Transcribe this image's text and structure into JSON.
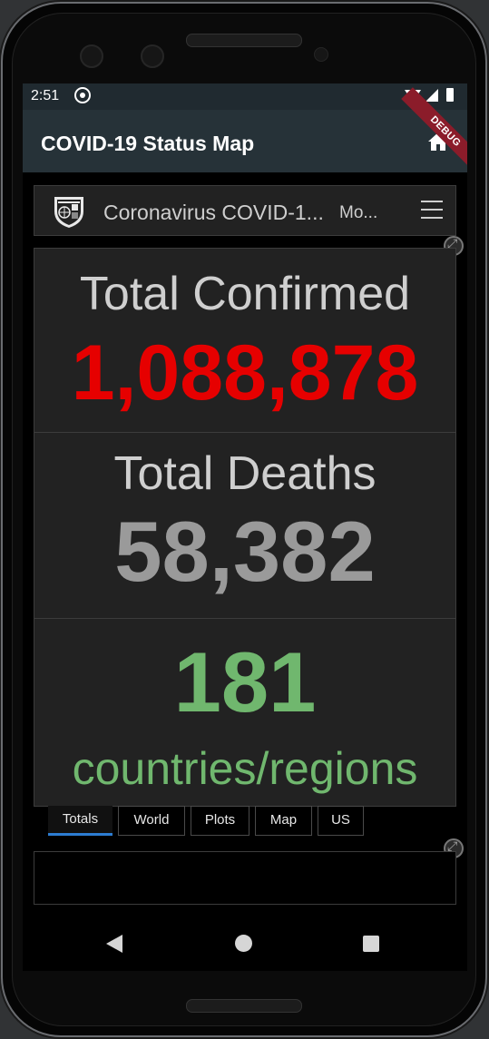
{
  "status_bar": {
    "time": "2:51"
  },
  "app_bar": {
    "title": "COVID-19 Status Map",
    "home_icon": "home-icon",
    "debug_banner": "DEBUG"
  },
  "dashboard": {
    "header_title": "Coronavirus COVID-1...",
    "header_more": "Mo...",
    "menu_icon": "hamburger-menu-icon"
  },
  "stats": {
    "confirmed_label": "Total Confirmed",
    "confirmed_value": "1,088,878",
    "deaths_label": "Total Deaths",
    "deaths_value": "58,382",
    "countries_value": "181",
    "countries_label": "countries/regions"
  },
  "tabs": [
    {
      "label": "Totals",
      "active": true
    },
    {
      "label": "World",
      "active": false
    },
    {
      "label": "Plots",
      "active": false
    },
    {
      "label": "Map",
      "active": false
    },
    {
      "label": "US",
      "active": false
    }
  ],
  "colors": {
    "confirmed": "#e60000",
    "deaths": "#9a9a9a",
    "countries": "#70b76e",
    "app_bar": "#263238",
    "tab_indicator": "#2d7dd2"
  }
}
